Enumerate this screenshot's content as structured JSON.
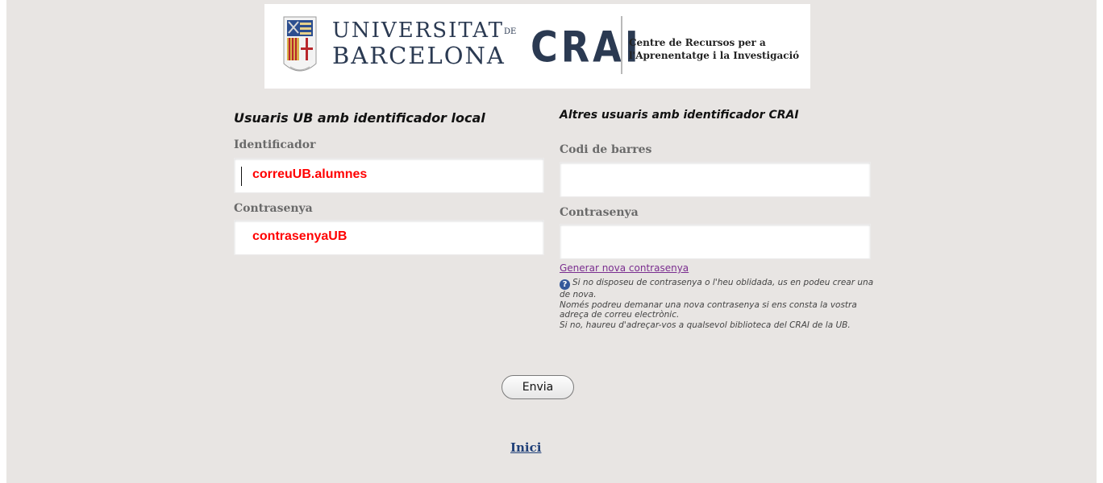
{
  "banner": {
    "university_line1": "UNIVERSITAT",
    "university_de": "DE",
    "university_line2": "BARCELONA",
    "crai_logo": "CRAI",
    "crai_desc_line1": "Centre de Recursos per a",
    "crai_desc_line2": "l'Aprenentatge i la Investigació",
    "crest_icon": "university-crest-icon",
    "brand_color": "#2b3a52"
  },
  "left_column": {
    "title": "Usuaris UB amb identificador local",
    "id_label": "Identificador",
    "id_hint": "correuUB.alumnes",
    "password_label": "Contrasenya",
    "password_hint": "contrasenyaUB"
  },
  "right_column": {
    "title": "Altres usuaris amb identificador CRAI",
    "barcode_label": "Codi de barres",
    "barcode_value": "",
    "password_label": "Contrasenya",
    "password_value": "",
    "generate_link": "Generar nova contrasenya",
    "help_icon": "info-icon",
    "help_text": "Si no disposeu de contrasenya o l'heu oblidada, us en podeu crear una de nova.",
    "help_text_2": "Només podreu demanar una nova contrasenya si ens consta la vostra adreça de correu electrònic.",
    "help_text_3": "Si no, haureu d'adreçar-vos a qualsevol biblioteca del CRAI de la UB."
  },
  "actions": {
    "submit_label": "Envia",
    "home_link": "Inici"
  },
  "colors": {
    "page_background": "#e8e5e3",
    "hint_text": "#ff0000",
    "visited_link": "#7a2d8f",
    "home_link": "#1f3f78"
  }
}
